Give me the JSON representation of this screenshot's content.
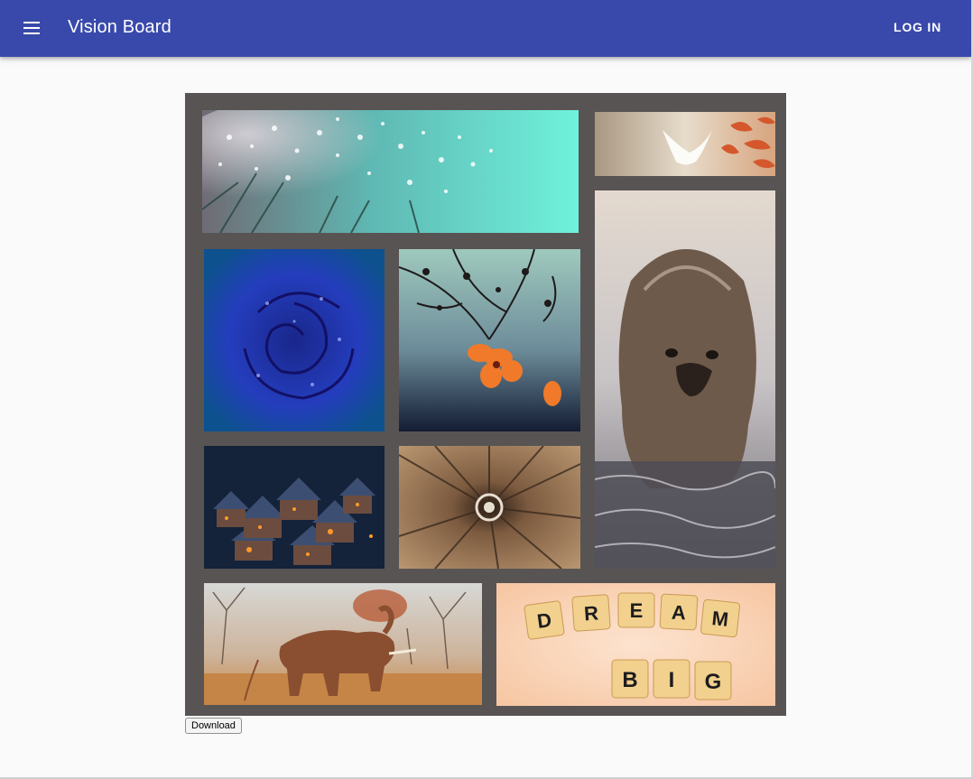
{
  "header": {
    "title": "Vision Board",
    "login_label": "LOG IN",
    "menu_icon": "menu-icon",
    "bar_color": "#3949ab"
  },
  "board": {
    "background": "#585454",
    "images": [
      {
        "name": "dandelion-water-drops"
      },
      {
        "name": "white-dove-autumn-leaves"
      },
      {
        "name": "blue-rose-dew"
      },
      {
        "name": "orange-blossom-branches"
      },
      {
        "name": "otter-in-water"
      },
      {
        "name": "snowy-village-at-night"
      },
      {
        "name": "spiral-staircase"
      },
      {
        "name": "elephant-dust-bath"
      },
      {
        "name": "dream-big-scrabble-tiles"
      }
    ]
  },
  "scrabble": {
    "word1": [
      "D",
      "R",
      "E",
      "A",
      "M"
    ],
    "word2": [
      "B",
      "I",
      "G"
    ]
  },
  "download_label": "Download"
}
